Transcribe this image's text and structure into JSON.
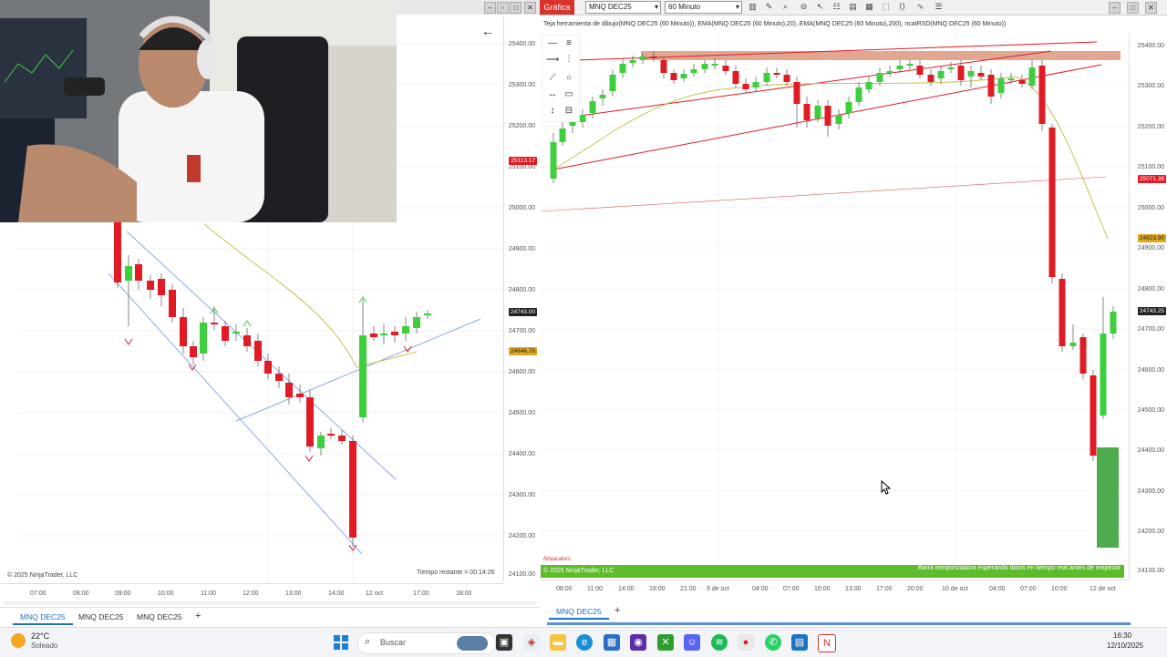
{
  "left_window": {
    "price_labels": [
      "25400.00",
      "25300.00",
      "25200.00",
      "25100.00",
      "25000.00",
      "24900.00",
      "24800.00",
      "24700.00",
      "24600.00",
      "24500.00",
      "24400.00",
      "24300.00",
      "24200.00",
      "24100.00"
    ],
    "price_tag_red": "25113.17",
    "price_tag_dark": "24743.00",
    "price_tag_yellow": "24646.78",
    "time_labels": [
      "07:00",
      "08:00",
      "09:00",
      "10:00",
      "11:00",
      "12:00",
      "13:00",
      "14:00",
      "12 oct",
      "17:00",
      "18:00"
    ],
    "copyright": "© 2025 NinjaTrader, LLC",
    "remaining": "Tiempo restante = 00:14:26",
    "tabs": [
      "MNQ DEC25",
      "MNQ DEC25",
      "MNQ DEC25"
    ],
    "add_tab": "+",
    "back_arrow": "←",
    "colors": {
      "up": "#3ecf3e",
      "down": "#e01b24",
      "trend": "#8ca9e8"
    }
  },
  "right_window": {
    "grafica": "Gráfica",
    "instrument": "MNQ DEC25",
    "interval": "60 Minuto",
    "indicators": "Teja herramienta de dibujo(MNQ DEC25 (60 Minuto)), EMA(MNQ DEC25 (60 Minuto),20), EMA(MNQ DEC25 (60 Minuto),200), ncatRSD(MNQ DEC25 (60 Minuto))",
    "price_labels": [
      "25400.00",
      "25300.00",
      "25200.00",
      "25100.00",
      "25000.00",
      "24900.00",
      "24800.00",
      "24700.00",
      "24600.00",
      "24500.00",
      "24400.00",
      "24300.00",
      "24200.00",
      "24100.00"
    ],
    "price_tag_red": "25071.38",
    "price_tag_yellow": "24923.90",
    "price_tag_dark": "24743.25",
    "time_labels": [
      "08:00",
      "11:00",
      "14:00",
      "18:00",
      "21:00",
      "9 de oct",
      "04:00",
      "07:00",
      "10:00",
      "13:00",
      "17:00",
      "20:00",
      "10 de oct",
      "04:00",
      "07:00",
      "10:00",
      "12 de oct"
    ],
    "watermark": "Ninjacators",
    "footer_left": "© 2025 NinjaTrader, LLC",
    "footer_right": "Barra temporizadora esperando datos en tiempo real antes de empezar",
    "tab": "MNQ DEC25",
    "add_tab": "+"
  },
  "taskbar": {
    "temperature": "22°C",
    "weather": "Soleado",
    "search_placeholder": "Buscar",
    "time": "16:30",
    "date": "12/10/2025"
  }
}
